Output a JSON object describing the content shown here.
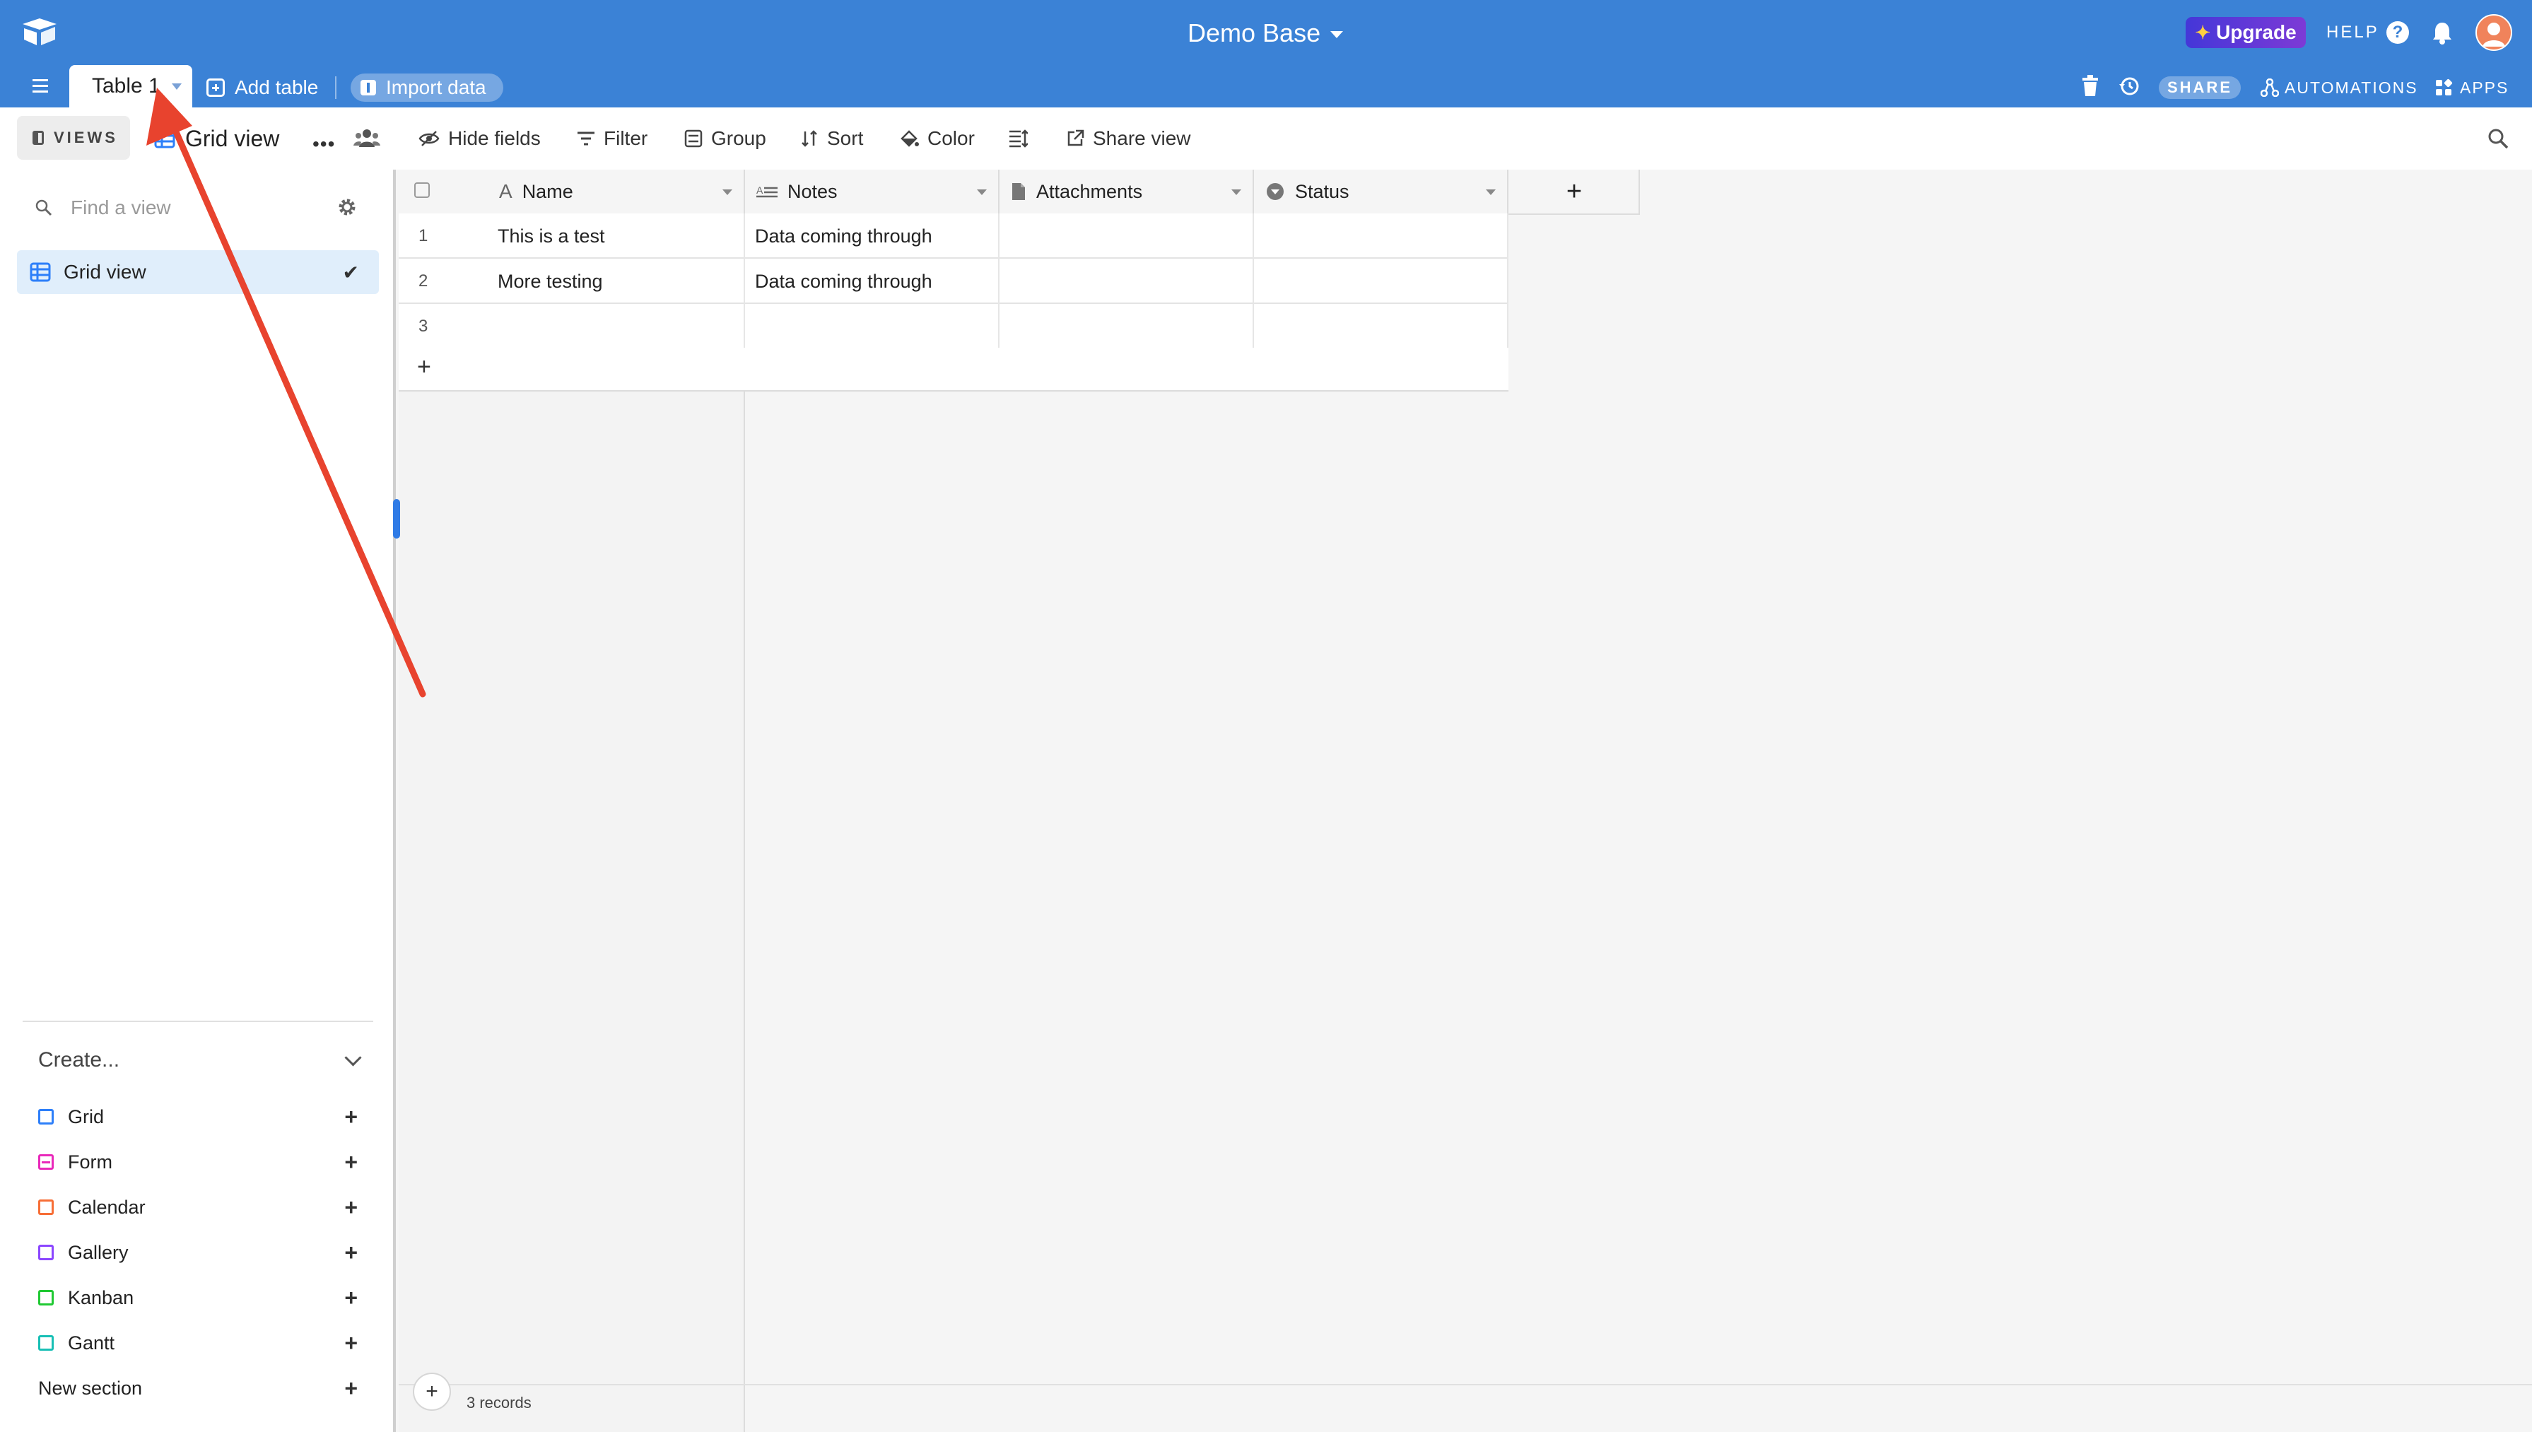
{
  "header": {
    "base_title": "Demo Base",
    "upgrade_label": "Upgrade",
    "help_label": "HELP",
    "share_label": "SHARE",
    "automations_label": "AUTOMATIONS",
    "apps_label": "APPS"
  },
  "tabs": {
    "active_table": "Table 1",
    "add_table_label": "Add table",
    "import_label": "Import data"
  },
  "toolbar": {
    "views_label": "VIEWS",
    "view_name": "Grid view",
    "hide_fields": "Hide fields",
    "filter": "Filter",
    "group": "Group",
    "sort": "Sort",
    "color": "Color",
    "share_view": "Share view"
  },
  "sidebar": {
    "find_placeholder": "Find a view",
    "active_view": "Grid view",
    "create_label": "Create...",
    "create_items": [
      {
        "label": "Grid",
        "color": "#2d7ff9"
      },
      {
        "label": "Form",
        "color": "#e929ba"
      },
      {
        "label": "Calendar",
        "color": "#f76e36"
      },
      {
        "label": "Gallery",
        "color": "#8b46ff"
      },
      {
        "label": "Kanban",
        "color": "#20c933"
      },
      {
        "label": "Gantt",
        "color": "#18bfb5"
      }
    ],
    "new_section_label": "New section"
  },
  "grid": {
    "columns": [
      "Name",
      "Notes",
      "Attachments",
      "Status"
    ],
    "rows": [
      {
        "num": "1",
        "name": "This is a test",
        "notes": "Data coming through",
        "attachments": "",
        "status": ""
      },
      {
        "num": "2",
        "name": "More testing",
        "notes": "Data coming through",
        "attachments": "",
        "status": ""
      },
      {
        "num": "3",
        "name": "",
        "notes": "",
        "attachments": "",
        "status": ""
      }
    ],
    "records_count": "3 records"
  },
  "colors": {
    "topbar": "#3b82d6",
    "annotation_arrow": "#e8432e"
  }
}
